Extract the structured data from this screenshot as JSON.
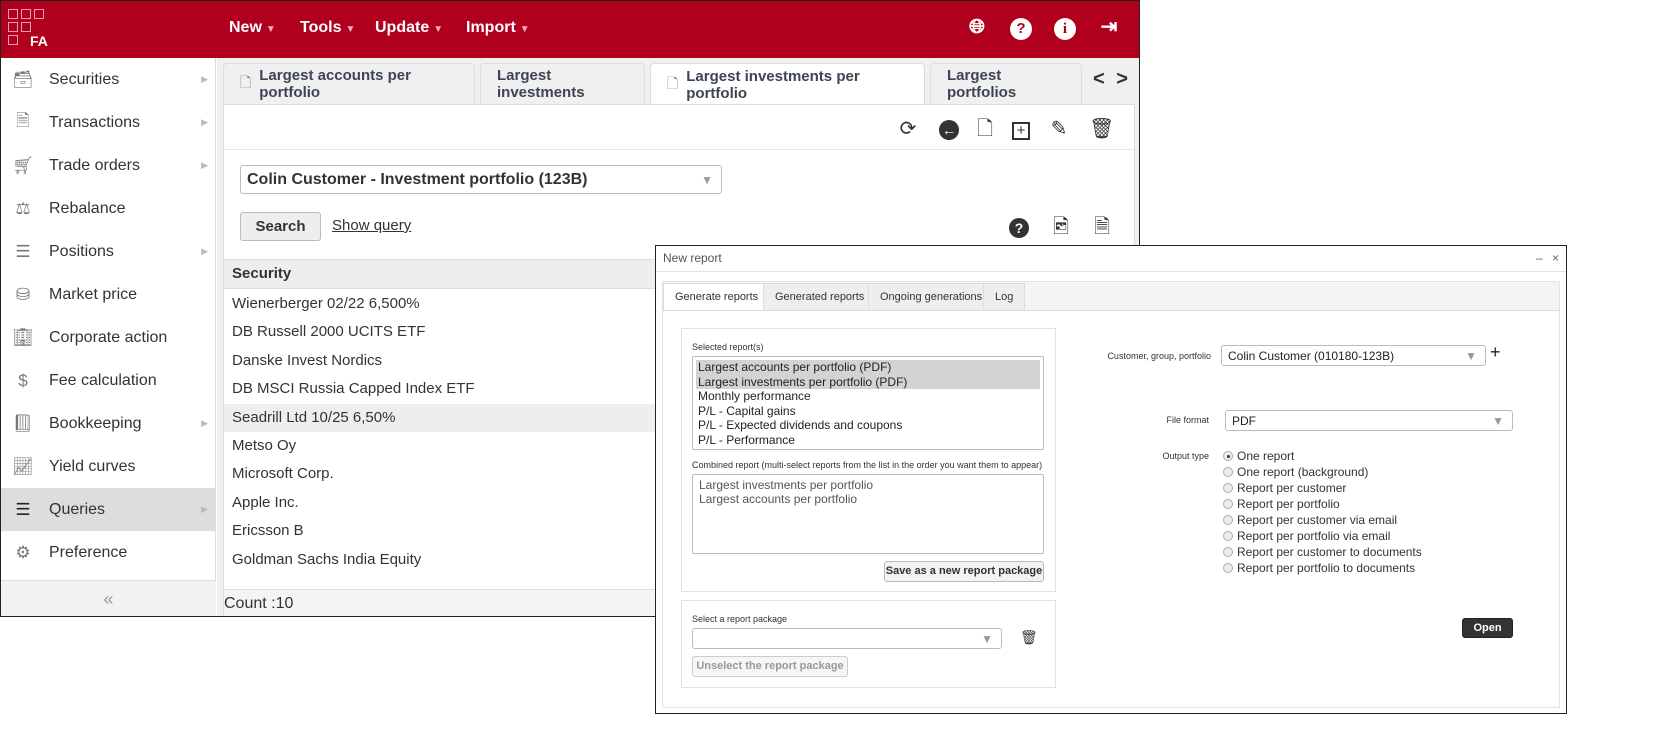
{
  "app": {
    "logo_text": "FA",
    "brand_color": "#b0001e"
  },
  "header": {
    "menus": [
      {
        "label": "New"
      },
      {
        "label": "Tools"
      },
      {
        "label": "Update"
      },
      {
        "label": "Import"
      }
    ],
    "icons": [
      "globe-icon",
      "help-icon",
      "info-icon",
      "logout-icon"
    ]
  },
  "sidebar": {
    "items": [
      {
        "label": "Securities",
        "icon": "securities-icon",
        "arrow": true
      },
      {
        "label": "Transactions",
        "icon": "transactions-icon",
        "arrow": true
      },
      {
        "label": "Trade orders",
        "icon": "cart-icon",
        "arrow": true
      },
      {
        "label": "Rebalance",
        "icon": "scale-icon",
        "arrow": false
      },
      {
        "label": "Positions",
        "icon": "positions-icon",
        "arrow": true
      },
      {
        "label": "Market price",
        "icon": "coins-icon",
        "arrow": false
      },
      {
        "label": "Corporate action",
        "icon": "building-icon",
        "arrow": false
      },
      {
        "label": "Fee calculation",
        "icon": "fee-icon",
        "arrow": false
      },
      {
        "label": "Bookkeeping",
        "icon": "book-icon",
        "arrow": true
      },
      {
        "label": "Yield curves",
        "icon": "chart-line-icon",
        "arrow": false
      },
      {
        "label": "Queries",
        "icon": "list-icon",
        "arrow": true,
        "active": true
      },
      {
        "label": "Preference",
        "icon": "gears-icon",
        "arrow": false
      }
    ],
    "collapse": "«"
  },
  "tabs": [
    {
      "label": "Largest accounts per portfolio",
      "doc": true
    },
    {
      "label": "Largest investments",
      "doc": false
    },
    {
      "label": "Largest investments per portfolio",
      "doc": true,
      "active": true
    },
    {
      "label": "Largest portfolios",
      "doc": false
    }
  ],
  "tab_nav": {
    "prev": "<",
    "next": ">"
  },
  "query": {
    "portfolio_select": "Colin Customer - Investment portfolio (123B)",
    "search_label": "Search",
    "show_query_label": "Show query"
  },
  "table": {
    "column": "Security",
    "rows": [
      "Wienerberger 02/22 6,500%",
      "DB Russell 2000 UCITS ETF",
      "Danske Invest Nordics",
      "DB MSCI Russia Capped Index ETF",
      "Seadrill Ltd 10/25 6,50%",
      "Metso Oy",
      "Microsoft Corp.",
      "Apple Inc.",
      "Ericsson B",
      "Goldman Sachs India Equity"
    ],
    "highlighted_row": 4,
    "count": "Count :10"
  },
  "dialog": {
    "title": "New report",
    "minimize": "–",
    "close": "×",
    "tabs": [
      "Generate reports",
      "Generated reports",
      "Ongoing generations",
      "Log"
    ],
    "selected_label": "Selected report(s)",
    "reports": [
      "Largest accounts per portfolio (PDF)",
      "Largest investments per portfolio (PDF)",
      "Monthly performance",
      "P/L - Capital gains",
      "P/L - Expected dividends and coupons",
      "P/L - Performance"
    ],
    "selected_count": 2,
    "combined_label": "Combined report (multi-select reports from the list in the order you want them to appear)",
    "combined": [
      "Largest investments per portfolio",
      "Largest accounts per portfolio"
    ],
    "save_package": "Save as a new report package",
    "package_label": "Select a report package",
    "package_value": "",
    "unselect_package": "Unselect the report package",
    "customer_label": "Customer, group, portfolio",
    "customer_value": "Colin Customer (010180-123B)",
    "add": "+",
    "format_label": "File format",
    "format_value": "PDF",
    "output_label": "Output type",
    "output_options": [
      "One report",
      "One report (background)",
      "Report per customer",
      "Report per portfolio",
      "Report per customer via email",
      "Report per portfolio via email",
      "Report per customer to documents",
      "Report per portfolio to documents"
    ],
    "output_selected": 0,
    "open": "Open"
  }
}
